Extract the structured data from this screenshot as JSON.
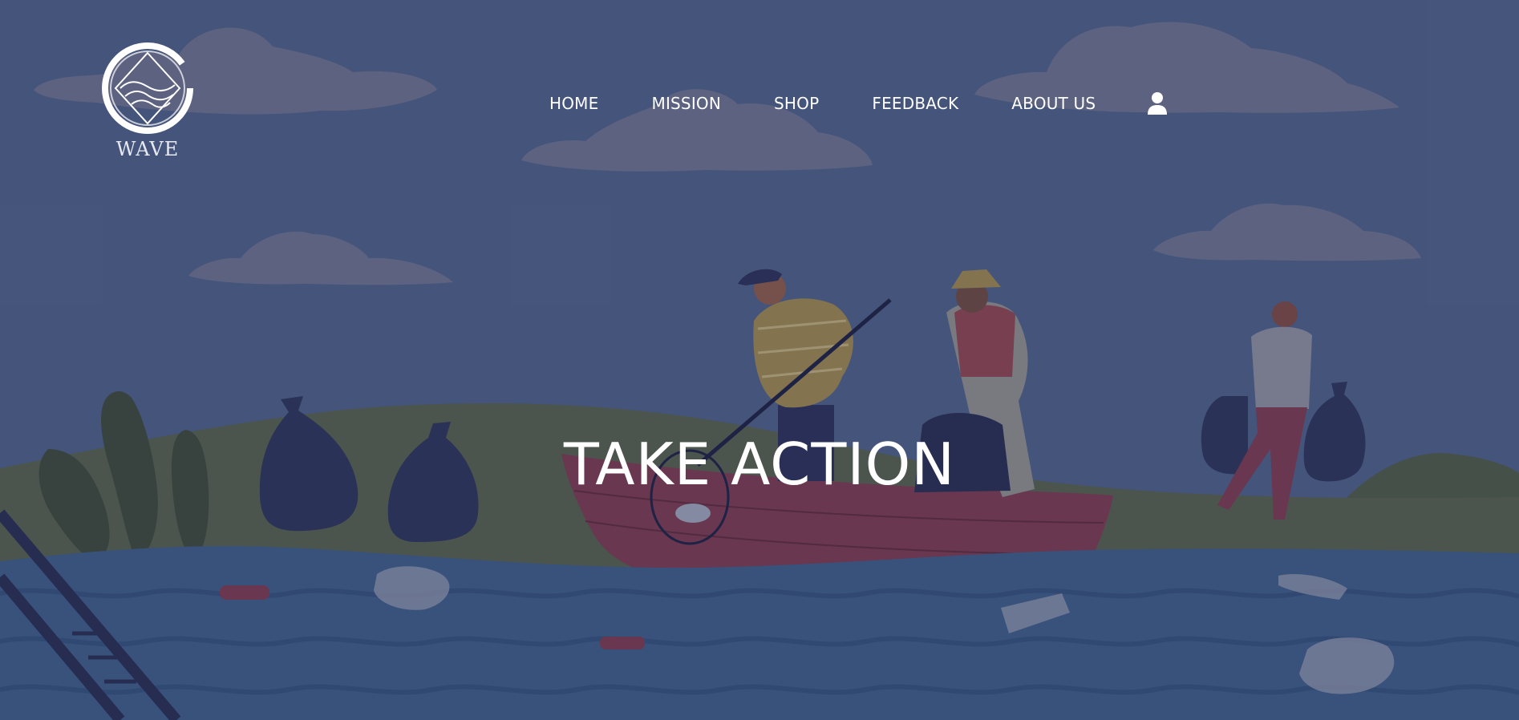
{
  "brand": {
    "name": "WAVE",
    "logo_icon": "wave-diamond-logo-icon"
  },
  "nav": {
    "items": [
      {
        "label": "HOME"
      },
      {
        "label": "MISSION"
      },
      {
        "label": "SHOP"
      },
      {
        "label": "FEEDBACK"
      },
      {
        "label": "ABOUT US"
      }
    ],
    "account_icon": "user-icon"
  },
  "hero": {
    "headline": "TAKE ACTION"
  },
  "colors": {
    "sky": "#4e5f85",
    "cloud": "#6a6f8c",
    "hill": "#56604d",
    "water": "#3f5c86",
    "boat": "#7a3b50",
    "text": "#ffffff"
  }
}
